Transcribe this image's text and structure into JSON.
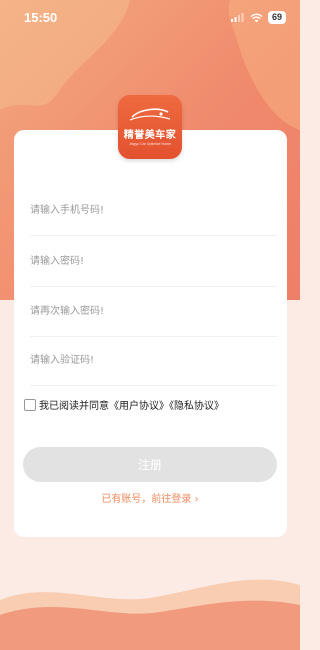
{
  "status_bar": {
    "time": "15:50",
    "battery": "69"
  },
  "logo": {
    "name": "精誉美车家",
    "subtitle": "Jingyu Car Optimize Home"
  },
  "form": {
    "phone_placeholder": "请输入手机号码!",
    "password_placeholder": "请输入密码!",
    "confirm_placeholder": "请再次输入密码!",
    "code_placeholder": "请输入验证码!"
  },
  "agreement": {
    "text": "我已阅读并同意《用户协议》《隐私协议》",
    "checked": false
  },
  "register_button": {
    "label": "注册"
  },
  "login_link": {
    "label": "已有账号，前往登录 ›"
  },
  "colors": {
    "accent": "#EE8A5F",
    "logo_bg": "#E3512F",
    "button_disabled": "#E2E2E2"
  }
}
